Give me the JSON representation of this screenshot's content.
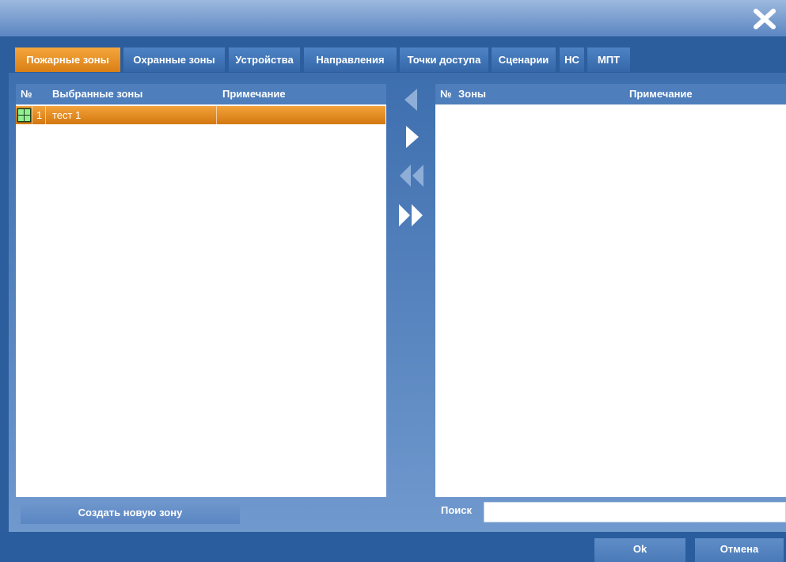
{
  "window": {
    "close_icon": "close-icon"
  },
  "tabs": {
    "items": [
      {
        "label": "Пожарные зоны",
        "active": true
      },
      {
        "label": "Охранные зоны",
        "active": false
      },
      {
        "label": "Устройства",
        "active": false
      },
      {
        "label": "Направления",
        "active": false
      },
      {
        "label": "Точки доступа",
        "active": false
      },
      {
        "label": "Сценарии",
        "active": false
      },
      {
        "label": "НС",
        "active": false
      },
      {
        "label": "МПТ",
        "active": false
      }
    ]
  },
  "left_table": {
    "headers": {
      "num": "№",
      "zones": "Выбранные зоны",
      "note": "Примечание"
    },
    "rows": [
      {
        "icon": "zone-grid-icon",
        "num": "1",
        "name": "тест 1",
        "note": "",
        "selected": true
      }
    ]
  },
  "right_table": {
    "headers": {
      "num": "№",
      "zones": "Зоны",
      "note": "Примечание"
    },
    "rows": []
  },
  "transfer": {
    "buttons": [
      {
        "icon": "arrow-left-icon",
        "enabled": false
      },
      {
        "icon": "arrow-right-icon",
        "enabled": true
      },
      {
        "icon": "double-arrow-left-icon",
        "enabled": false
      },
      {
        "icon": "double-arrow-right-icon",
        "enabled": true
      }
    ]
  },
  "create_button": {
    "label": "Создать новую зону"
  },
  "search": {
    "label": "Поиск",
    "value": "",
    "placeholder": ""
  },
  "footer": {
    "ok_label": "Ok",
    "cancel_label": "Отмена"
  },
  "colors": {
    "accent_orange": "#e08a22",
    "primary_blue": "#2c5e9e",
    "header_blue": "#4e7ebb",
    "enabled_arrow": "#ffffff",
    "disabled_arrow": "#8eaed8"
  }
}
